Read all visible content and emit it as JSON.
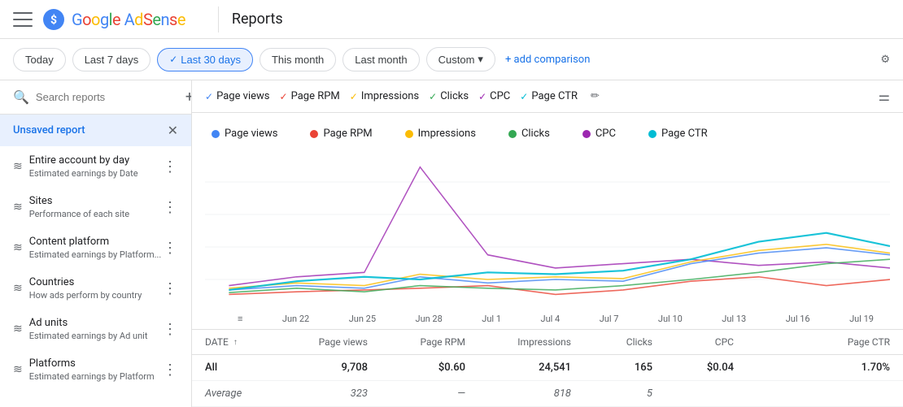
{
  "nav": {
    "logo_brand": "Google AdSense",
    "page_title": "Reports"
  },
  "date_bar": {
    "today": "Today",
    "last7": "Last 7 days",
    "last30": "Last 30 days",
    "this_month": "This month",
    "last_month": "Last month",
    "custom": "Custom",
    "add_comparison": "+ add comparison"
  },
  "sidebar": {
    "search_placeholder": "Search reports",
    "items": [
      {
        "label": "Unsaved report",
        "sub": "",
        "unsaved": true
      },
      {
        "label": "Entire account by day",
        "sub": "Estimated earnings by Date",
        "icon": "~"
      },
      {
        "label": "Sites",
        "sub": "Performance of each site",
        "icon": "~"
      },
      {
        "label": "Content platform",
        "sub": "Estimated earnings by Platform...",
        "icon": "~"
      },
      {
        "label": "Countries",
        "sub": "How ads perform by country",
        "icon": "~"
      },
      {
        "label": "Ad units",
        "sub": "Estimated earnings by Ad unit",
        "icon": "~"
      },
      {
        "label": "Platforms",
        "sub": "Estimated earnings by Platform",
        "icon": "~"
      }
    ]
  },
  "filter_chips": [
    {
      "label": "Page views",
      "class": "page-views",
      "color": "#4285f4"
    },
    {
      "label": "Page RPM",
      "class": "page-rpm",
      "color": "#ea4335"
    },
    {
      "label": "Impressions",
      "class": "impressions",
      "color": "#fbbc04"
    },
    {
      "label": "Clicks",
      "class": "clicks",
      "color": "#34a853"
    },
    {
      "label": "CPC",
      "class": "cpc",
      "color": "#9c27b0"
    },
    {
      "label": "Page CTR",
      "class": "page-ctr",
      "color": "#00bcd4"
    }
  ],
  "legend": [
    {
      "label": "Page views",
      "color": "#4285f4"
    },
    {
      "label": "Page RPM",
      "color": "#ea4335"
    },
    {
      "label": "Impressions",
      "color": "#fbbc04"
    },
    {
      "label": "Clicks",
      "color": "#34a853"
    },
    {
      "label": "CPC",
      "color": "#9c27b0"
    },
    {
      "label": "Page CTR",
      "color": "#00bcd4"
    }
  ],
  "chart": {
    "x_labels": [
      "Jun 22",
      "Jun 25",
      "Jun 28",
      "Jul 1",
      "Jul 4",
      "Jul 7",
      "Jul 10",
      "Jul 13",
      "Jul 16",
      "Jul 19"
    ]
  },
  "table": {
    "headers": {
      "date": "DATE",
      "page_views": "Page views",
      "page_rpm": "Page RPM",
      "impressions": "Impressions",
      "clicks": "Clicks",
      "cpc": "CPC",
      "page_ctr": "Page CTR"
    },
    "rows": [
      {
        "date": "All",
        "page_views": "9,708",
        "page_rpm": "$0.60",
        "impressions": "24,541",
        "clicks": "165",
        "cpc": "$0.04",
        "page_ctr": "1.70%"
      },
      {
        "date": "Average",
        "page_views": "323",
        "page_rpm": "—",
        "impressions": "818",
        "clicks": "5",
        "cpc": "",
        "page_ctr": ""
      }
    ]
  }
}
